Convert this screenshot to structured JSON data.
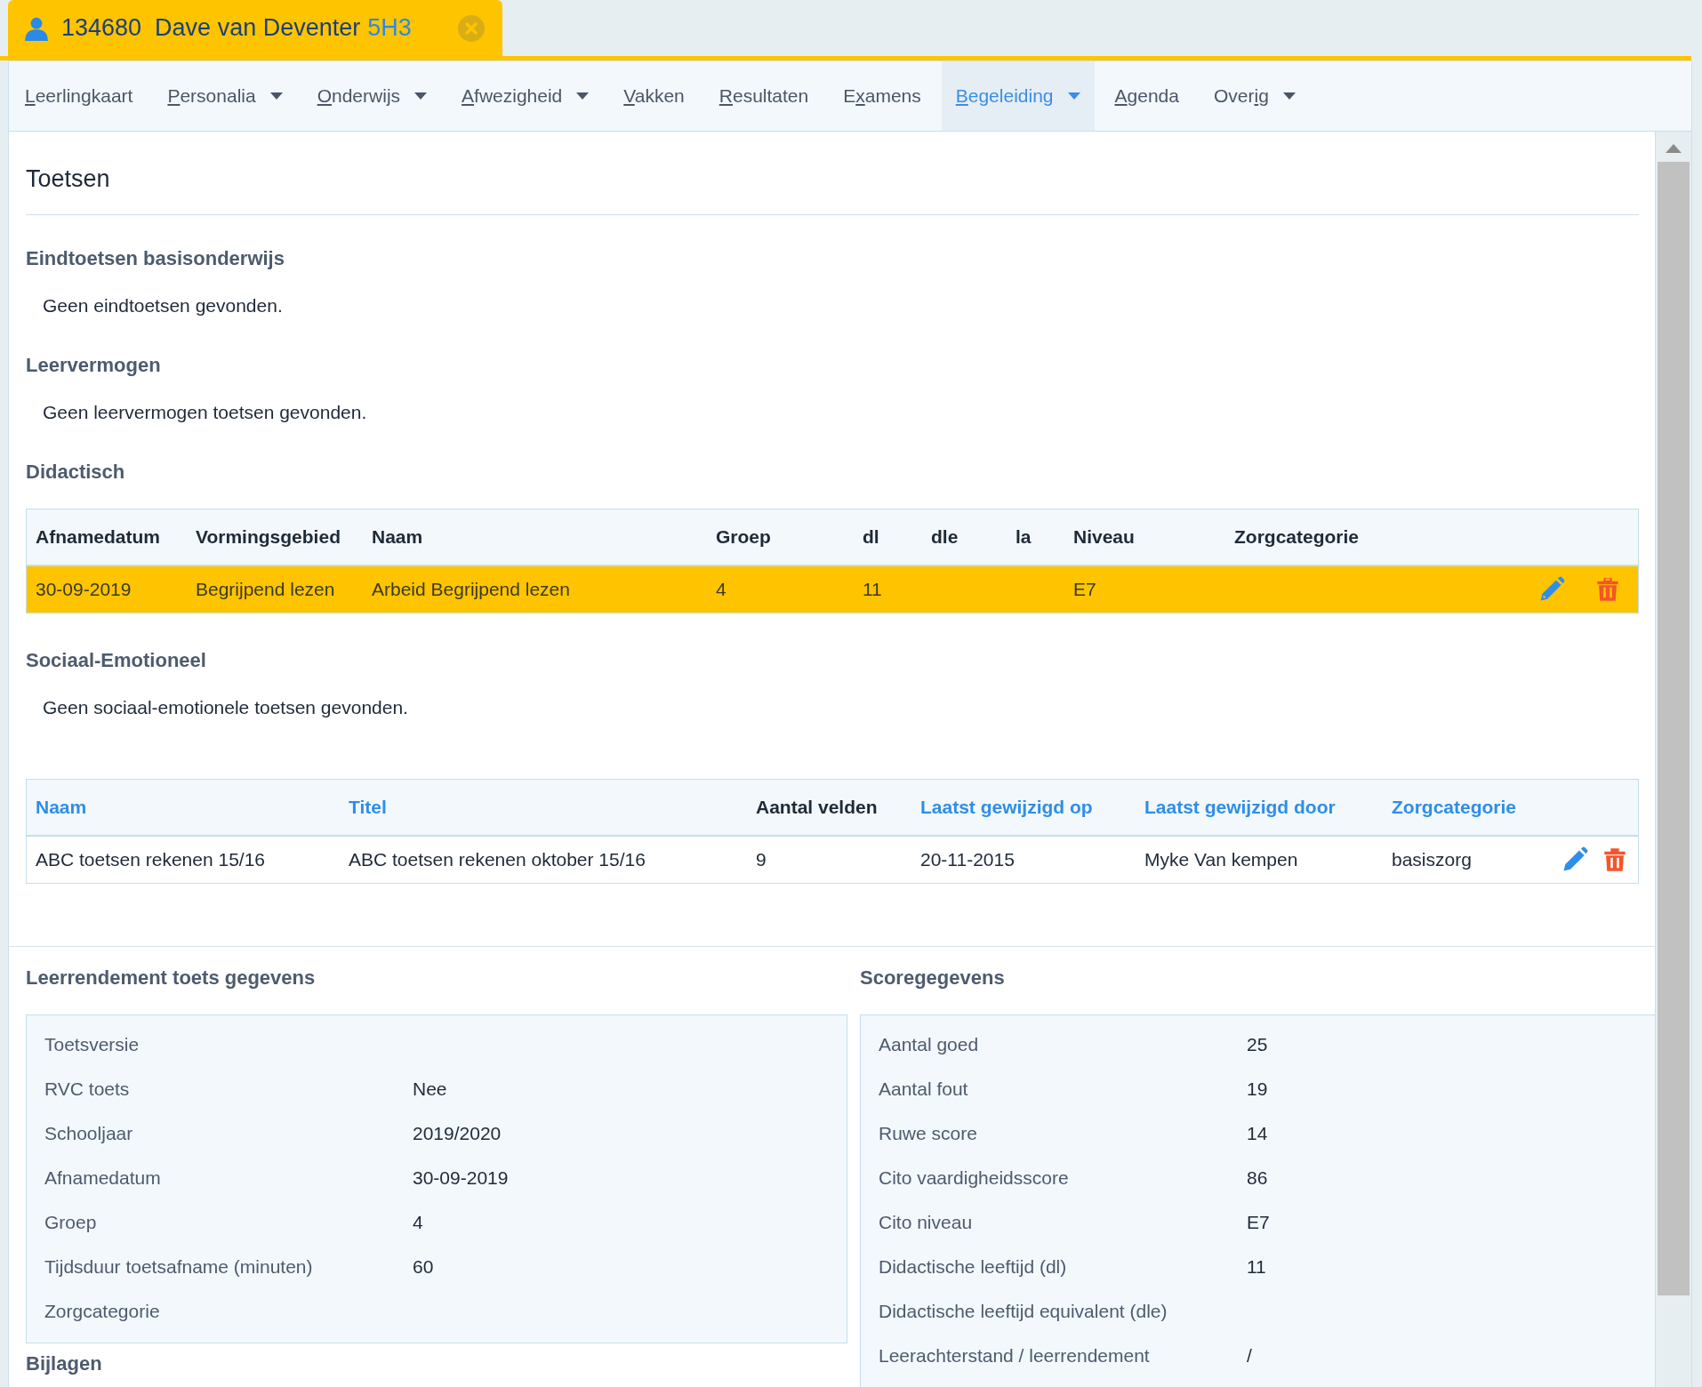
{
  "student_tab": {
    "number": "134680",
    "name": "Dave van Deventer",
    "class": "5H3"
  },
  "nav": [
    {
      "key": "L",
      "rest": "eerlingkaart",
      "dropdown": false,
      "selected": false
    },
    {
      "key": "P",
      "rest": "ersonalia",
      "dropdown": true,
      "selected": false
    },
    {
      "key": "O",
      "rest": "nderwijs",
      "dropdown": true,
      "selected": false
    },
    {
      "key": "A",
      "rest": "fwezigheid",
      "dropdown": true,
      "selected": false
    },
    {
      "key": "V",
      "rest": "akken",
      "dropdown": false,
      "selected": false
    },
    {
      "key": "R",
      "rest": "esultaten",
      "dropdown": false,
      "selected": false
    },
    {
      "lead": "E",
      "key": "x",
      "rest": "amens",
      "dropdown": false,
      "selected": false
    },
    {
      "key": "B",
      "rest": "egeleiding",
      "dropdown": true,
      "selected": true
    },
    {
      "key": "A",
      "rest": "genda",
      "dropdown": false,
      "selected": false
    },
    {
      "lead": "Over",
      "key": "i",
      "rest": "g",
      "dropdown": true,
      "selected": false
    }
  ],
  "page_title": "Toetsen",
  "sections": [
    {
      "heading": "Eindtoetsen basisonderwijs",
      "empty_text": "Geen eindtoetsen gevonden."
    },
    {
      "heading": "Leervermogen",
      "empty_text": "Geen leervermogen toetsen gevonden."
    },
    {
      "heading": "Didactisch",
      "table": {
        "columns": [
          "Afnamedatum",
          "Vormingsgebied",
          "Naam",
          "Groep",
          "dl",
          "dle",
          "la",
          "Niveau",
          "Zorgcategorie"
        ],
        "rows": [
          {
            "cells": [
              "30-09-2019",
              "Begrijpend lezen",
              "Arbeid Begrijpend lezen",
              "4",
              "11",
              "",
              "",
              "E7",
              ""
            ],
            "selected": true
          }
        ]
      }
    },
    {
      "heading": "Sociaal-Emotioneel",
      "empty_text": "Geen sociaal-emotionele toetsen gevonden."
    }
  ],
  "lists_table": {
    "columns": [
      {
        "label": "Naam",
        "sortable": true
      },
      {
        "label": "Titel",
        "sortable": true
      },
      {
        "label": "Aantal velden",
        "sortable": false
      },
      {
        "label": "Laatst gewijzigd op",
        "sortable": true
      },
      {
        "label": "Laatst gewijzigd door",
        "sortable": true
      },
      {
        "label": "Zorgcategorie",
        "sortable": true
      }
    ],
    "rows": [
      {
        "cells": [
          "ABC toetsen rekenen 15/16",
          "ABC toetsen rekenen oktober 15/16",
          "9",
          "20-11-2015",
          "Myke Van kempen",
          "basiszorg"
        ],
        "selected": false
      }
    ]
  },
  "details": [
    {
      "heading": "Leerrendement toets gegevens",
      "fields": [
        {
          "label": "Toetsversie"
        },
        {
          "label": "RVC toets",
          "value": "Nee"
        },
        {
          "label": "Schooljaar",
          "value": "2019/2020"
        },
        {
          "label": "Afnamedatum",
          "value": "30-09-2019"
        },
        {
          "label": "Groep",
          "value": "4"
        },
        {
          "label": "Tijdsduur toetsafname (minuten)",
          "value": "60"
        },
        {
          "label": "Zorgcategorie"
        }
      ]
    },
    {
      "heading": "Scoregegevens",
      "fields": [
        {
          "label": "Aantal goed",
          "value": "25"
        },
        {
          "label": "Aantal fout",
          "value": "19"
        },
        {
          "label": "Ruwe score",
          "value": "14"
        },
        {
          "label": "Cito vaardigheidsscore",
          "value": "86"
        },
        {
          "label": "Cito niveau",
          "value": "E7"
        },
        {
          "label": "Didactische leeftijd (dl)",
          "value": "11"
        },
        {
          "label": "Didactische leeftijd equivalent (dle)"
        },
        {
          "label": "Leerachterstand / leerrendement",
          "value": "/"
        }
      ]
    }
  ],
  "attachments_heading": "Bijlagen"
}
